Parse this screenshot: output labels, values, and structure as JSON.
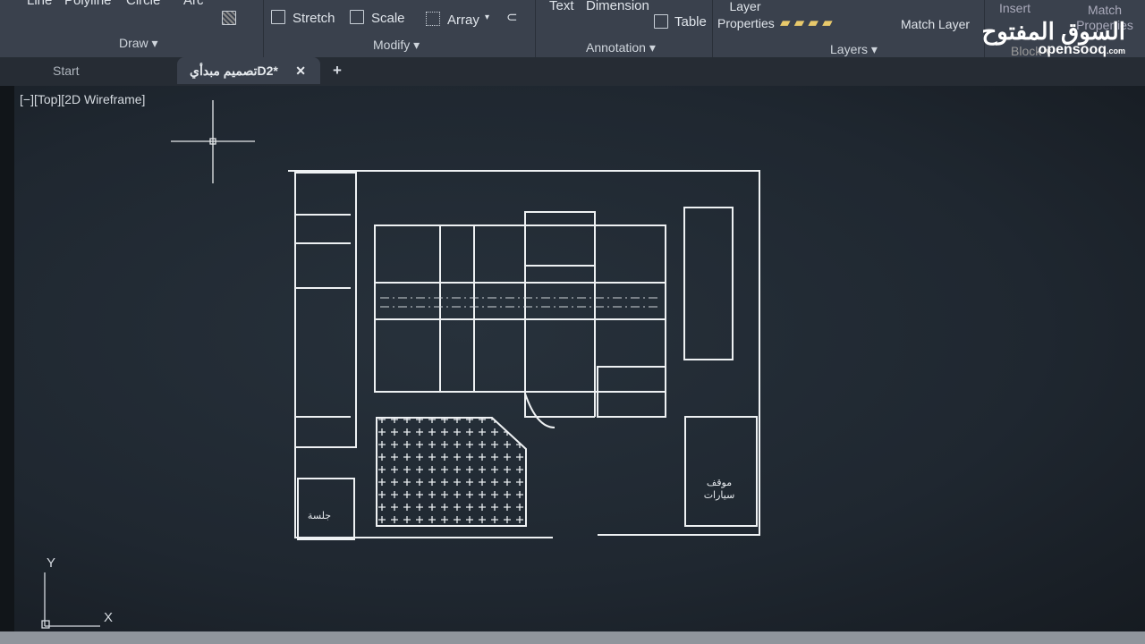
{
  "ribbon": {
    "draw_tools": [
      "Line",
      "Polyline",
      "Circle",
      "Arc"
    ],
    "modify_tools": [
      "Stretch",
      "Scale",
      "Array"
    ],
    "annotation_tools": [
      "Text",
      "Dimension",
      "Table"
    ],
    "layers_tools": [
      "Layer Properties",
      "Match Layer"
    ],
    "block_tools": [
      "Insert",
      "Match Properties"
    ],
    "panels": [
      "Draw",
      "Modify",
      "Annotation",
      "Layers",
      "Block"
    ]
  },
  "tabs": {
    "start": "Start",
    "active": "تصميم مبدأيD2*",
    "new": "+"
  },
  "viewport": {
    "label": "[−][Top][2D Wireframe]"
  },
  "drawing": {
    "parking": "موقف سيارات",
    "parking_l1": "موقف",
    "parking_l2": "سيارات",
    "seating": "جلسة"
  },
  "ucs": {
    "x": "X",
    "y": "Y"
  },
  "watermark": {
    "arabic": "السوق المفتوح",
    "latin": "opensooq",
    "suffix": ".com"
  }
}
